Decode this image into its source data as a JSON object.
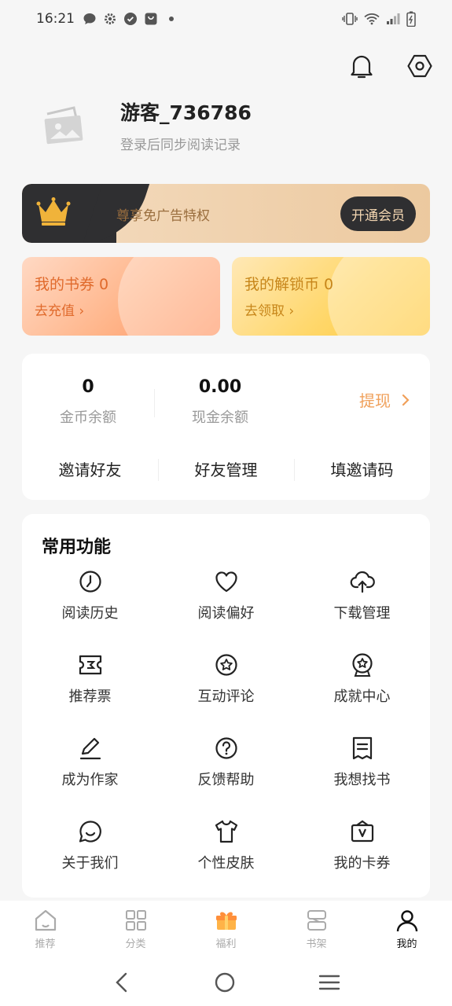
{
  "status_bar": {
    "time": "16:21"
  },
  "profile": {
    "username": "游客_736786",
    "login_hint": "登录后同步阅读记录"
  },
  "vip": {
    "text": "尊享免广告特权",
    "button": "开通会员"
  },
  "cards": {
    "coupon": {
      "title": "我的书券 0",
      "action": "去充值 ›"
    },
    "unlock": {
      "title": "我的解锁币 0",
      "action": "去领取 ›"
    }
  },
  "wallet": {
    "coin_value": "0",
    "coin_label": "金币余额",
    "cash_value": "0.00",
    "cash_label": "现金余额",
    "withdraw": "提现",
    "links": [
      "邀请好友",
      "好友管理",
      "填邀请码"
    ]
  },
  "functions": {
    "title": "常用功能",
    "items": [
      {
        "label": "阅读历史",
        "icon": "clock-icon"
      },
      {
        "label": "阅读偏好",
        "icon": "heart-icon"
      },
      {
        "label": "下载管理",
        "icon": "cloud-upload-icon"
      },
      {
        "label": "推荐票",
        "icon": "ticket-icon"
      },
      {
        "label": "互动评论",
        "icon": "star-circle-icon"
      },
      {
        "label": "成就中心",
        "icon": "badge-icon"
      },
      {
        "label": "成为作家",
        "icon": "pen-icon"
      },
      {
        "label": "反馈帮助",
        "icon": "question-icon"
      },
      {
        "label": "我想找书",
        "icon": "document-icon"
      },
      {
        "label": "关于我们",
        "icon": "chat-smile-icon"
      },
      {
        "label": "个性皮肤",
        "icon": "tshirt-icon"
      },
      {
        "label": "我的卡券",
        "icon": "voucher-icon"
      }
    ]
  },
  "bottom_nav": {
    "items": [
      {
        "label": "推荐",
        "icon": "home-icon"
      },
      {
        "label": "分类",
        "icon": "grid-icon"
      },
      {
        "label": "福利",
        "icon": "gift-icon"
      },
      {
        "label": "书架",
        "icon": "bookshelf-icon"
      },
      {
        "label": "我的",
        "icon": "user-icon",
        "active": true
      }
    ]
  },
  "colors": {
    "accent": "#f0a05a",
    "vip_dark": "#2f2f31",
    "coupon_text": "#e06a2c",
    "unlock_text": "#c7861a"
  }
}
